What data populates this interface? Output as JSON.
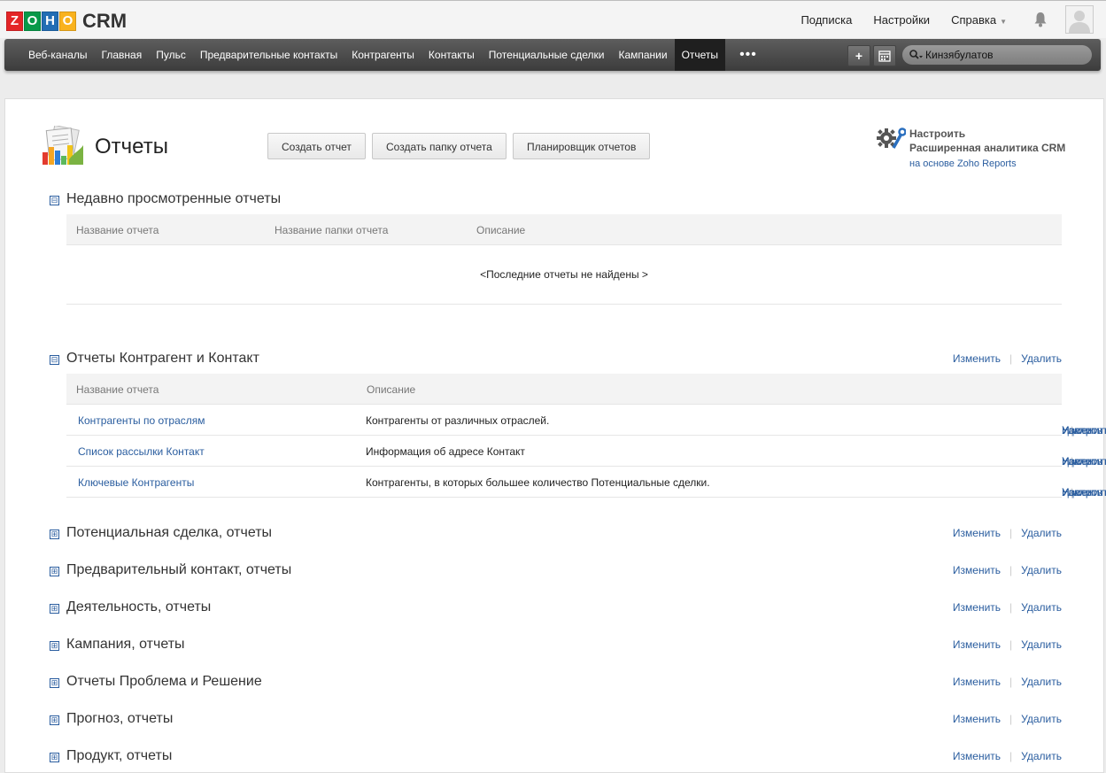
{
  "app": {
    "logo_letters": [
      "Z",
      "O",
      "H",
      "O"
    ],
    "logo_colors": [
      "#e42527",
      "#089949",
      "#226db4",
      "#f9b21d"
    ],
    "product": "CRM"
  },
  "top": {
    "subscription": "Подписка",
    "settings": "Настройки",
    "help": "Справка"
  },
  "nav": {
    "items": [
      "Веб-каналы",
      "Главная",
      "Пульс",
      "Предварительные контакты",
      "Контрагенты",
      "Контакты",
      "Потенциальные сделки",
      "Кампании",
      "Отчеты"
    ],
    "active_index": 8,
    "more": "•••",
    "search_value": "Кинзябулатов"
  },
  "page": {
    "title": "Отчеты",
    "buttons": {
      "create_report": "Создать отчет",
      "create_folder": "Создать папку отчета",
      "scheduler": "Планировщик отчетов"
    },
    "analytics": {
      "line1": "Настроить",
      "line2": "Расширенная аналитика CRM",
      "line3": "на основе Zoho Reports"
    }
  },
  "sections": {
    "recent": {
      "title": "Недавно просмотренные отчеты",
      "columns": [
        "Название отчета",
        "Название папки отчета",
        "Описание"
      ],
      "empty": "<Последние отчеты не найдены >"
    },
    "accounts": {
      "title": "Отчеты Контрагент и Контакт",
      "edit": "Изменить",
      "delete": "Удалить",
      "columns": [
        "Название отчета",
        "Описание"
      ],
      "rows": [
        {
          "name": "Контрагенты по отраслям",
          "desc": "Контрагенты от различных отраслей.",
          "edit": "Изменить",
          "customize": "Настроить",
          "delete": "Удалить"
        },
        {
          "name": "Список рассылки Контакт",
          "desc": "Информация об адресе Контакт",
          "edit": "Изменить",
          "customize": "Настроить",
          "delete": "Удалить"
        },
        {
          "name": "Ключевые Контрагенты",
          "desc": "Контрагенты, в которых большее количество Потенциальные сделки.",
          "edit": "Изменить",
          "customize": "Настроить",
          "delete": "Удалить"
        }
      ]
    },
    "collapsed": [
      {
        "title": "Потенциальная сделка, отчеты",
        "edit": "Изменить",
        "delete": "Удалить"
      },
      {
        "title": "Предварительный контакт, отчеты",
        "edit": "Изменить",
        "delete": "Удалить"
      },
      {
        "title": "Деятельность, отчеты",
        "edit": "Изменить",
        "delete": "Удалить"
      },
      {
        "title": "Кампания, отчеты",
        "edit": "Изменить",
        "delete": "Удалить"
      },
      {
        "title": "Отчеты Проблема и Решение",
        "edit": "Изменить",
        "delete": "Удалить"
      },
      {
        "title": "Прогноз, отчеты",
        "edit": "Изменить",
        "delete": "Удалить"
      },
      {
        "title": "Продукт, отчеты",
        "edit": "Изменить",
        "delete": "Удалить"
      }
    ]
  },
  "icons": {
    "collapse": "⊟",
    "expand": "⊞"
  },
  "colors": {
    "link": "#2a5d9f",
    "navbar": "#4a4a4a",
    "active_tab": "#1f1f1f"
  }
}
